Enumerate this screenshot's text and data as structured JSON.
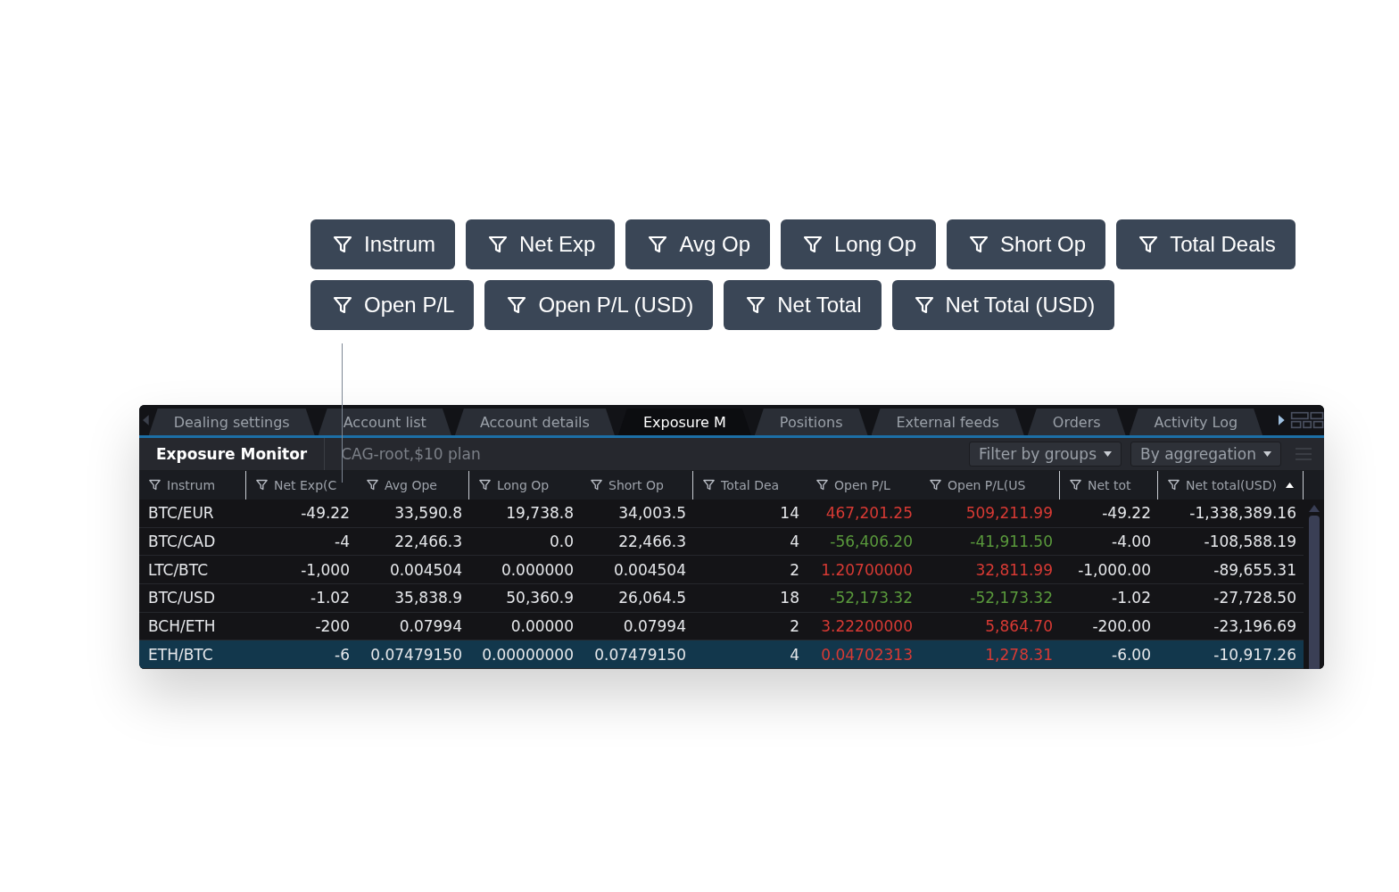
{
  "filter_chips": [
    {
      "label": "Instrum"
    },
    {
      "label": "Net Exp"
    },
    {
      "label": "Avg Op"
    },
    {
      "label": "Long Op"
    },
    {
      "label": "Short Op"
    },
    {
      "label": "Total Deals"
    },
    {
      "label": "Open P/L"
    },
    {
      "label": "Open P/L (USD)"
    },
    {
      "label": "Net Total"
    },
    {
      "label": "Net Total (USD)"
    }
  ],
  "tabs": [
    {
      "label": "Dealing settings",
      "selected": false
    },
    {
      "label": "Account list",
      "selected": false
    },
    {
      "label": "Account details",
      "selected": false
    },
    {
      "label": "Exposure M",
      "selected": true
    },
    {
      "label": "Positions",
      "selected": false
    },
    {
      "label": "External feeds",
      "selected": false
    },
    {
      "label": "Orders",
      "selected": false
    },
    {
      "label": "Activity Log",
      "selected": false
    }
  ],
  "toolbar": {
    "title": "Exposure Monitor",
    "account": "CAG-root,$10 plan",
    "dropdowns": [
      "Filter by groups",
      "By aggregation"
    ]
  },
  "table": {
    "columns": [
      {
        "label": "Instrum",
        "sorted": false
      },
      {
        "label": "Net Exp(C",
        "sorted": false
      },
      {
        "label": "Avg Ope",
        "sorted": false
      },
      {
        "label": "Long Op",
        "sorted": false
      },
      {
        "label": "Short Op",
        "sorted": false
      },
      {
        "label": "Total Dea",
        "sorted": false
      },
      {
        "label": "Open P/L",
        "sorted": false
      },
      {
        "label": "Open P/L(US",
        "sorted": false
      },
      {
        "label": "Net tot",
        "sorted": false
      },
      {
        "label": "Net total(USD)",
        "sorted": true
      }
    ],
    "rows": [
      {
        "selected": false,
        "color": "#d83a34",
        "cells": [
          "BTC/EUR",
          "-49.22",
          "33,590.8",
          "19,738.8",
          "34,003.5",
          "14",
          "467,201.25",
          "509,211.99",
          "-49.22",
          "-1,338,389.16"
        ]
      },
      {
        "selected": false,
        "color": "#5a9a3c",
        "cells": [
          "BTC/CAD",
          "-4",
          "22,466.3",
          "0.0",
          "22,466.3",
          "4",
          "-56,406.20",
          "-41,911.50",
          "-4.00",
          "-108,588.19"
        ]
      },
      {
        "selected": false,
        "color": "#d83a34",
        "cells": [
          "LTC/BTC",
          "-1,000",
          "0.004504",
          "0.000000",
          "0.004504",
          "2",
          "1.20700000",
          "32,811.99",
          "-1,000.00",
          "-89,655.31"
        ]
      },
      {
        "selected": false,
        "color": "#5a9a3c",
        "cells": [
          "BTC/USD",
          "-1.02",
          "35,838.9",
          "50,360.9",
          "26,064.5",
          "18",
          "-52,173.32",
          "-52,173.32",
          "-1.02",
          "-27,728.50"
        ]
      },
      {
        "selected": false,
        "color": "#d83a34",
        "cells": [
          "BCH/ETH",
          "-200",
          "0.07994",
          "0.00000",
          "0.07994",
          "2",
          "3.22200000",
          "5,864.70",
          "-200.00",
          "-23,196.69"
        ]
      },
      {
        "selected": true,
        "color": "#d83a34",
        "cells": [
          "ETH/BTC",
          "-6",
          "0.07479150",
          "0.00000000",
          "0.07479150",
          "4",
          "0.04702313",
          "1,278.31",
          "-6.00",
          "-10,917.26"
        ]
      }
    ]
  }
}
